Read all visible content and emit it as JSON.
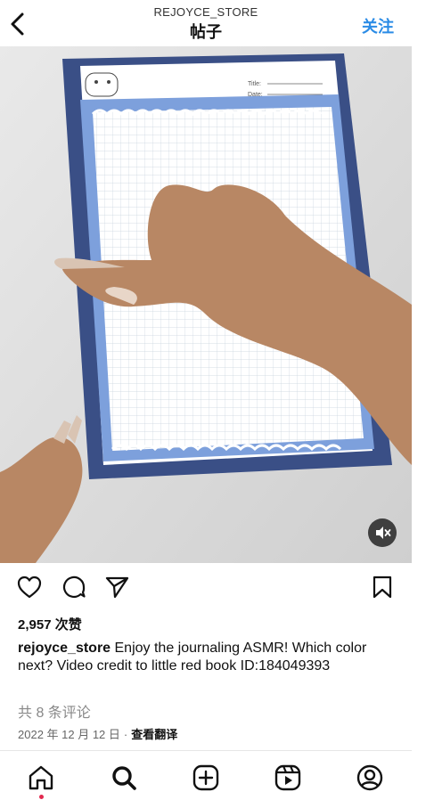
{
  "header": {
    "username": "REJOYCE_STORE",
    "title": "帖子",
    "follow_label": "关注"
  },
  "media": {
    "paper_title_label": "Title:",
    "paper_date_label": "Date:",
    "accent_color": "#6f92d4",
    "frame_color": "#3a4f86"
  },
  "post": {
    "likes": "2,957 次赞",
    "caption_user": "rejoyce_store",
    "caption_text": " Enjoy the journaling ASMR! Which color next? Video credit to little red book ID:184049393",
    "comments": "共 8 条评论",
    "date": "2022 年 12 月 12 日",
    "separator": "·",
    "translate": "查看翻译"
  },
  "icons": {
    "back": "chevron-left-icon",
    "like": "heart-icon",
    "comment": "comment-icon",
    "share": "send-icon",
    "save": "bookmark-icon",
    "mute": "speaker-muted-icon",
    "home": "home-icon",
    "search": "search-icon",
    "create": "plus-square-icon",
    "reels": "reels-icon",
    "profile": "profile-icon"
  },
  "colors": {
    "follow": "#2b8ce6",
    "notification_dot": "#e2294f"
  }
}
